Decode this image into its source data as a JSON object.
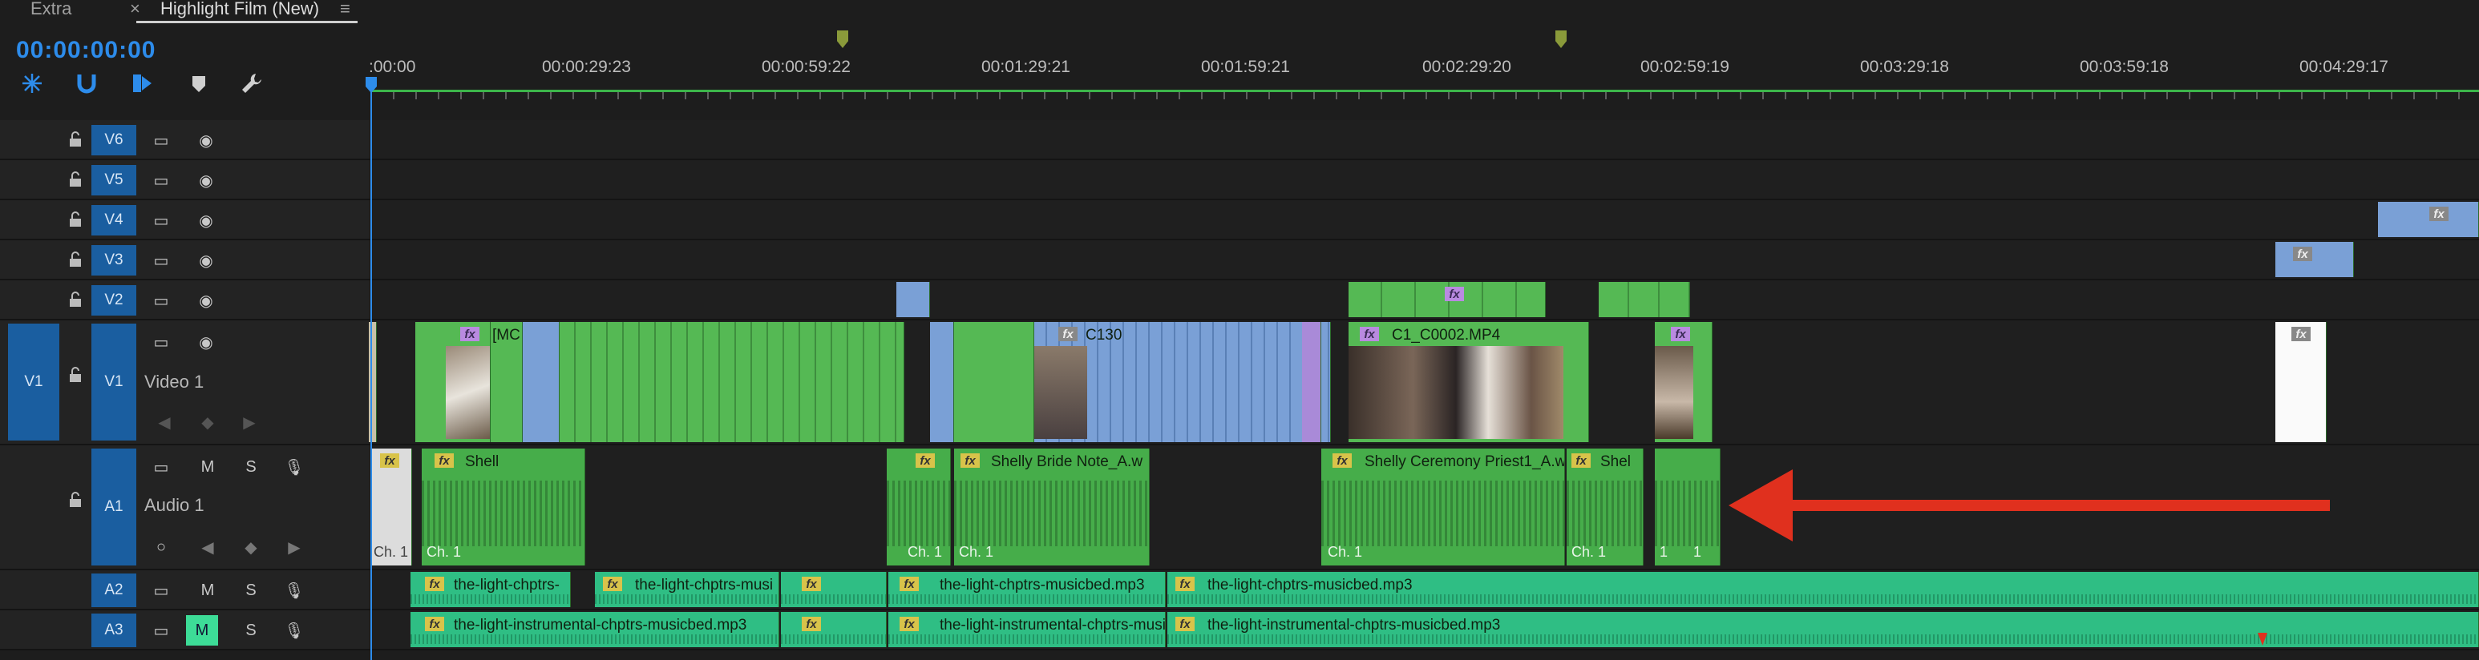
{
  "tabs": [
    {
      "label": "Extra"
    },
    {
      "label": "Highlight Film (New)",
      "close": "×",
      "menu": "≡"
    }
  ],
  "timecode": "00:00:00:00",
  "tools": [
    "snap-icon",
    "linked-selection-icon",
    "insert-edit-icon",
    "add-marker-icon",
    "wrench-icon"
  ],
  "ruler": {
    "labels": [
      ":00:00",
      "00:00:29:23",
      "00:00:59:22",
      "00:01:29:21",
      "00:01:59:21",
      "00:02:29:20",
      "00:02:59:19",
      "00:03:29:18",
      "00:03:59:18",
      "00:04:29:17"
    ]
  },
  "tracks": {
    "V6": {
      "name": "V6"
    },
    "V5": {
      "name": "V5"
    },
    "V4": {
      "name": "V4"
    },
    "V3": {
      "name": "V3"
    },
    "V2": {
      "name": "V2"
    },
    "V1": {
      "source": "V1",
      "name": "V1",
      "title": "Video 1"
    },
    "A1": {
      "name": "A1",
      "title": "Audio 1",
      "mute": "M",
      "solo": "S"
    },
    "A2": {
      "name": "A2",
      "mute": "M",
      "solo": "S"
    },
    "A3": {
      "name": "A3",
      "mute": "M",
      "solo": "S"
    }
  },
  "clips": {
    "v1_mc": "[MC",
    "v1_c130": "C130",
    "v1_c1": "C1_C0002.MP4",
    "a1_shell": "Shell",
    "a1_bride": "Shelly Bride Note_A.w",
    "a1_ceremony": "Shelly Ceremony Priest1_A.w",
    "a1_shel": "Shel",
    "ch1": "Ch. 1",
    "a1_small1": "1",
    "a2_1": "the-light-chptrs-",
    "a2_2": "the-light-chptrs-musi",
    "a2_3": "the-light-chptrs-musicbed.mp3",
    "a2_4": "the-light-chptrs-musicbed.mp3",
    "a3_1": "the-light-instrumental-chptrs-musicbed.mp3",
    "a3_2": "the-light-instrumental-chptrs-musicb",
    "a3_3": "the-light-instrumental-chptrs-musicbed.mp3",
    "fx": "fx"
  },
  "colors": {
    "accent": "#2d8ceb",
    "video_clip": "#55b954",
    "blue_clip": "#7aa0d6",
    "music_clip": "#2fbe84",
    "annotation_arrow": "#e0301e"
  }
}
